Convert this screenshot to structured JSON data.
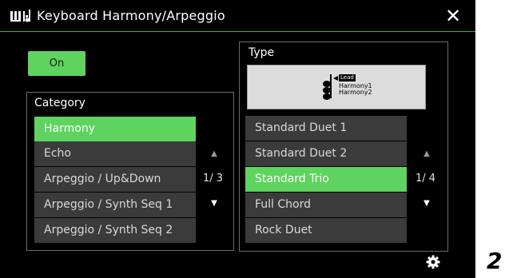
{
  "window": {
    "title": "Keyboard Harmony/Arpeggio",
    "close_label": "✕"
  },
  "on_button": {
    "label": "On"
  },
  "category": {
    "label": "Category",
    "items": [
      {
        "label": "Harmony",
        "selected": true
      },
      {
        "label": "Echo",
        "selected": false
      },
      {
        "label": "Arpeggio / Up&Down",
        "selected": false
      },
      {
        "label": "Arpeggio / Synth Seq 1",
        "selected": false
      },
      {
        "label": "Arpeggio / Synth Seq 2",
        "selected": false
      }
    ],
    "page": "1/ 3",
    "up_arrow": "▲",
    "down_arrow": "▼"
  },
  "type": {
    "label": "Type",
    "preview": {
      "lead": "Lead",
      "harmony1": "Harmony1",
      "harmony2": "Harmony2"
    },
    "items": [
      {
        "label": "Standard Duet 1",
        "selected": false
      },
      {
        "label": "Standard Duet 2",
        "selected": false
      },
      {
        "label": "Standard Trio",
        "selected": true
      },
      {
        "label": "Full Chord",
        "selected": false
      },
      {
        "label": "Rock Duet",
        "selected": false
      }
    ],
    "page": "1/ 4",
    "up_arrow": "▲",
    "down_arrow": "▼"
  },
  "callout": {
    "number": "2"
  },
  "colors": {
    "selected_green": "#5fd35f",
    "row_gray": "#3b3b3b",
    "background": "#000000",
    "title_underline": "#3fae3f"
  },
  "icons": {
    "app": "keyboard-icon",
    "close": "close-icon",
    "gear": "gear-icon"
  }
}
